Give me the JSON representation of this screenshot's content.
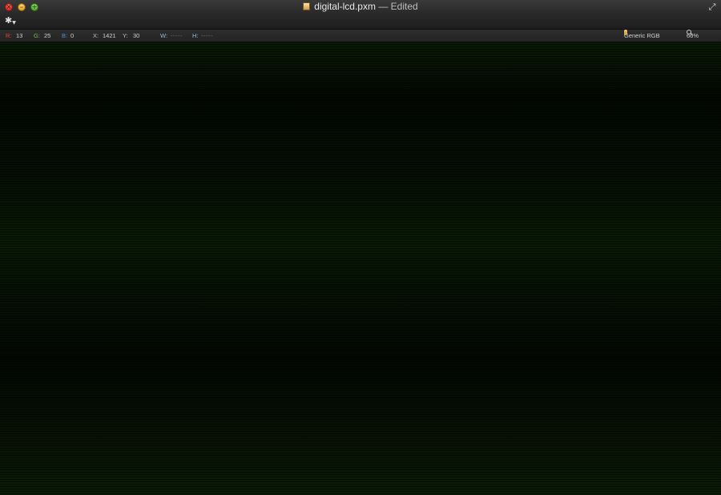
{
  "window": {
    "title": "digital-lcd.pxm",
    "title_separator": "—",
    "title_status": "Edited"
  },
  "icons": {
    "close": "close-button-icon",
    "minimize": "minimize-button-icon",
    "zoom": "zoom-button-icon",
    "document": "pxm-document-icon",
    "fullscreen": "fullscreen-arrows-icon",
    "gear": "gear-icon",
    "color_profile": "color-profile-icon",
    "zoom_level": "magnifier-icon"
  },
  "info": {
    "r_label": "R:",
    "r_value": "13",
    "g_label": "G:",
    "g_value": "25",
    "b_label": "B:",
    "b_value": "0",
    "x_label": "X:",
    "x_value": "1421",
    "y_label": "Y:",
    "y_value": "30",
    "w_label": "W:",
    "w_value": "-----",
    "h_label": "H:",
    "h_value": "-----",
    "color_profile": "Generic RGB",
    "zoom": "66%"
  },
  "colors": {
    "red_label": "#e2462f",
    "green_label": "#6cc24a",
    "blue_label": "#4d8fe0",
    "canvas_green": "#0a1c06"
  }
}
